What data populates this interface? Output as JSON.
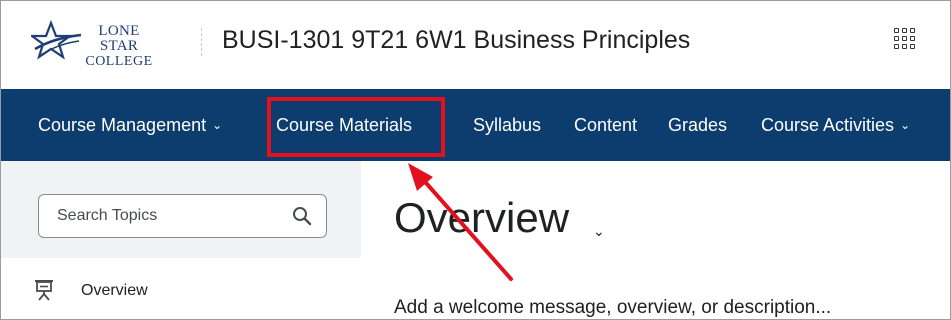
{
  "header": {
    "logo": {
      "line1": "LONE STAR",
      "line2": "COLLEGE"
    },
    "course_title": "BUSI-1301 9T21 6W1 Business Principles",
    "apps_icon": "waffle-grid-icon"
  },
  "navbar": {
    "items": [
      {
        "label": "Course Management",
        "has_dropdown": true
      },
      {
        "label": "Course Materials",
        "has_dropdown": false,
        "highlighted": true
      },
      {
        "label": "Syllabus",
        "has_dropdown": false
      },
      {
        "label": "Content",
        "has_dropdown": false
      },
      {
        "label": "Grades",
        "has_dropdown": false
      },
      {
        "label": "Course Activities",
        "has_dropdown": true
      }
    ],
    "chevron": "⌄"
  },
  "sidebar": {
    "search": {
      "placeholder": "Search Topics",
      "icon": "search-icon"
    },
    "items": [
      {
        "label": "Overview",
        "icon": "presentation-board-icon",
        "selected": true
      }
    ]
  },
  "main": {
    "title": "Overview",
    "title_chevron": "⌄",
    "description": "Add a welcome message, overview, or description..."
  },
  "annotation": {
    "highlight_color": "#e3101d",
    "arrow_color": "#e3101d"
  },
  "colors": {
    "navbar": "#0d3d6e",
    "sidebar": "#f1f2f4",
    "logo": "#1e3f73"
  }
}
